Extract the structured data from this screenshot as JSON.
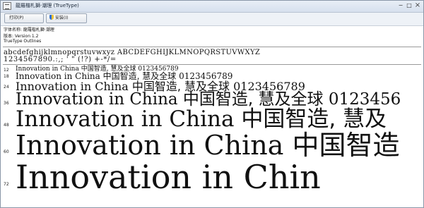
{
  "window": {
    "title": "龍羅楷札獅·潮理 (TrueType)",
    "controls": {
      "minimize": "−",
      "maximize": "□",
      "close": "×"
    }
  },
  "toolbar": {
    "print_label": "打印(P)",
    "install_label": "安装(I)",
    "install_icon": "shield-icon"
  },
  "info": {
    "font_name": "字体名称: 龍羅楷札獅·潮理",
    "version": "版本: Version 1.2",
    "type": "TrueType Outlines"
  },
  "charset": {
    "line1": "abcdefghijklmnopqrstuvwxyz ABCDEFGHIJKLMNOPQRSTUVWXYZ",
    "line2": "1234567890.:,; ' \" (!?) +-*/="
  },
  "samples": [
    {
      "size": "12",
      "latin": "Innovation in China ",
      "cjk": "中国智造, 慧及全球",
      "digits": " 0123456789"
    },
    {
      "size": "18",
      "latin": "Innovation in China ",
      "cjk": "中国智造, 慧及全球",
      "digits": " 0123456789"
    },
    {
      "size": "24",
      "latin": "Innovation in China ",
      "cjk": "中国智造, 慧及全球",
      "digits": " 0123456789"
    },
    {
      "size": "36",
      "latin": "Innovation in China ",
      "cjk": "中国智造, 慧及全球",
      "digits": " 0123456"
    },
    {
      "size": "48",
      "latin": "Innovation in China ",
      "cjk": "中国智造, 慧及",
      "digits": ""
    },
    {
      "size": "60",
      "latin": "Innovation in China ",
      "cjk": "中国智造",
      "digits": ""
    },
    {
      "size": "72",
      "latin": "Innovation in Chin",
      "cjk": "",
      "digits": ""
    }
  ]
}
